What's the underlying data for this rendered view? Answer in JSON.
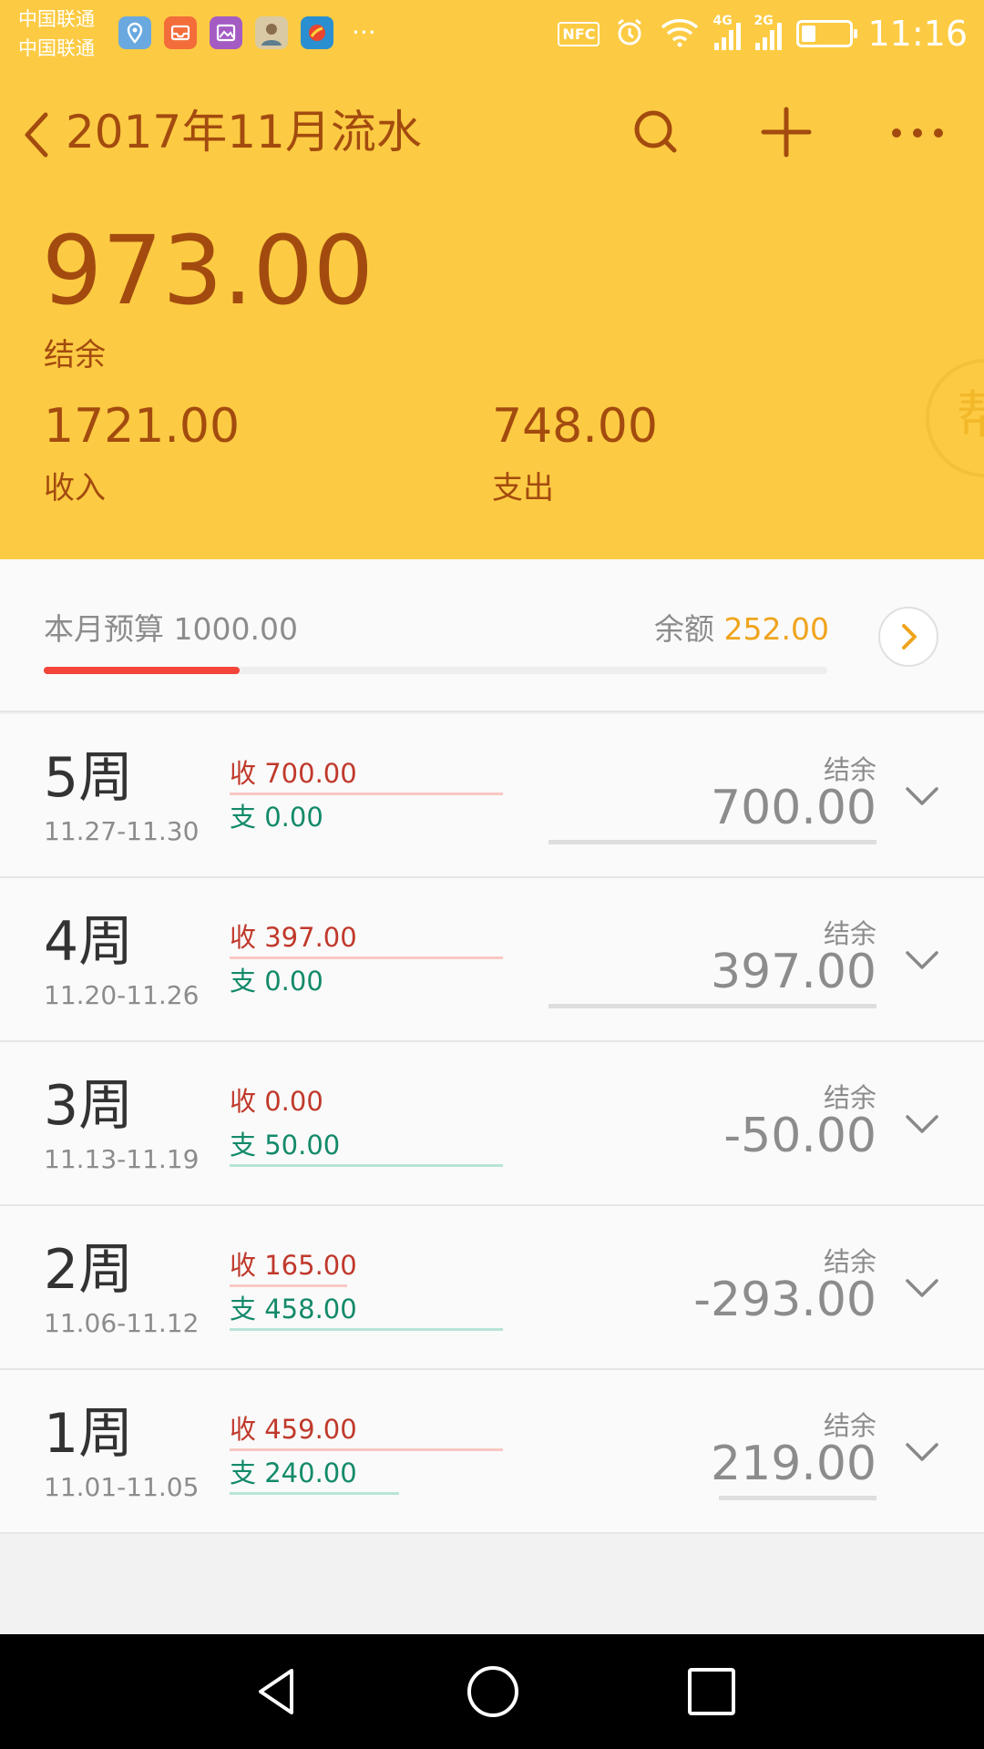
{
  "status_bar": {
    "carrier1": "中国联通",
    "carrier2": "中国联通",
    "more": "···",
    "nfc": "NFC",
    "signal1_label": "4G",
    "signal2_label": "2G",
    "battery_level": 0.3,
    "time": "11:16",
    "icons": [
      "location-icon",
      "inbox-icon",
      "gallery-icon",
      "avatar-icon",
      "app-icon"
    ]
  },
  "header": {
    "title": "2017年11月流水",
    "balance": "973.00",
    "balance_label": "结余",
    "income": "1721.00",
    "income_label": "收入",
    "expense": "748.00",
    "expense_label": "支出",
    "float_button_text": "帮",
    "accent_color": "#fccb43",
    "text_color": "#a34b0f"
  },
  "budget": {
    "label": "本月预算 1000.00",
    "remain_label": "余额",
    "remain_value": "252.00",
    "progress": 0.25
  },
  "weeks": [
    {
      "name": "5周",
      "dates": "11.27-11.30",
      "income_label": "收",
      "income": "700.00",
      "expense_label": "支",
      "expense": "0.00",
      "net_label": "结余",
      "net": "700.00",
      "income_ratio": 1.0,
      "expense_ratio": 0.0,
      "net_ratio": 1.0
    },
    {
      "name": "4周",
      "dates": "11.20-11.26",
      "income_label": "收",
      "income": "397.00",
      "expense_label": "支",
      "expense": "0.00",
      "net_label": "结余",
      "net": "397.00",
      "income_ratio": 1.0,
      "expense_ratio": 0.0,
      "net_ratio": 1.0
    },
    {
      "name": "3周",
      "dates": "11.13-11.19",
      "income_label": "收",
      "income": "0.00",
      "expense_label": "支",
      "expense": "50.00",
      "net_label": "结余",
      "net": "-50.00",
      "income_ratio": 0.0,
      "expense_ratio": 1.0,
      "net_ratio": 0.0
    },
    {
      "name": "2周",
      "dates": "11.06-11.12",
      "income_label": "收",
      "income": "165.00",
      "expense_label": "支",
      "expense": "458.00",
      "net_label": "结余",
      "net": "-293.00",
      "income_ratio": 0.43,
      "expense_ratio": 1.0,
      "net_ratio": 0.0
    },
    {
      "name": "1周",
      "dates": "11.01-11.05",
      "income_label": "收",
      "income": "459.00",
      "expense_label": "支",
      "expense": "240.00",
      "net_label": "结余",
      "net": "219.00",
      "income_ratio": 1.0,
      "expense_ratio": 0.62,
      "net_ratio": 0.48
    }
  ]
}
